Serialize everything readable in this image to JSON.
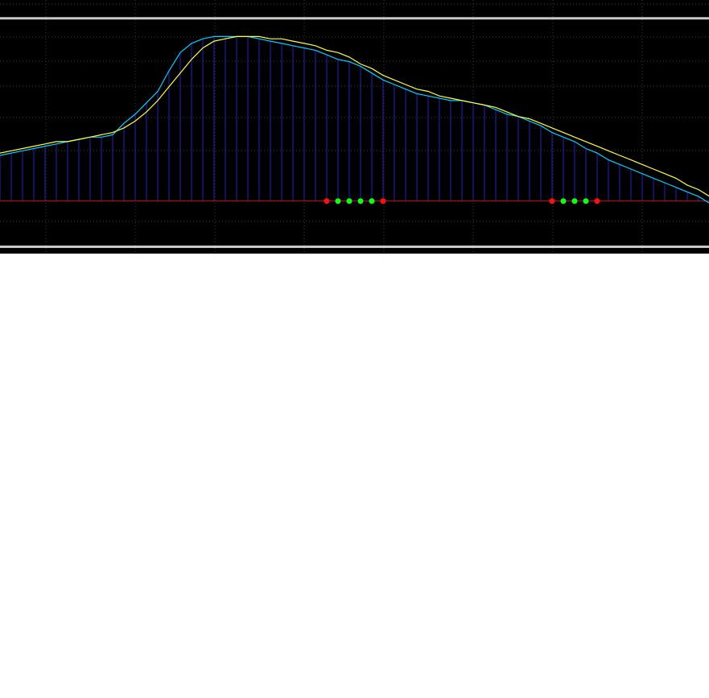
{
  "colors": {
    "background": "#000000",
    "grid": "#3a3a3a",
    "level_lines": "#c8c8c8",
    "positive_histogram": "#1a1aa8",
    "negative_histogram": "#d01010",
    "zero_line": "#d01010",
    "fast_line": "#00cfff",
    "signal_line": "#ffff40",
    "dot_red": "#ff1010",
    "dot_green": "#10ff10"
  },
  "chart_data": {
    "type": "line",
    "title": "",
    "xlabel": "",
    "ylabel": "",
    "grid": true,
    "ylim": [
      -0.23,
      0.88
    ],
    "levels": [
      0.8,
      -0.2
    ],
    "zero_level": 0,
    "histogram": [
      0.2,
      0.21,
      0.22,
      0.23,
      0.24,
      0.25,
      0.26,
      0.27,
      0.28,
      0.28,
      0.29,
      0.34,
      0.38,
      0.43,
      0.48,
      0.57,
      0.65,
      0.69,
      0.71,
      0.72,
      0.72,
      0.72,
      0.72,
      0.71,
      0.7,
      0.69,
      0.68,
      0.67,
      0.66,
      0.64,
      0.62,
      0.61,
      0.59,
      0.56,
      0.53,
      0.51,
      0.49,
      0.47,
      0.46,
      0.45,
      0.44,
      0.44,
      0.43,
      0.42,
      0.4,
      0.38,
      0.37,
      0.35,
      0.33,
      0.3,
      0.28,
      0.26,
      0.23,
      0.21,
      0.18,
      0.16,
      0.14,
      0.12,
      0.1,
      0.08,
      0.06,
      0.04,
      0.02,
      -0.01,
      -0.03,
      -0.05,
      -0.08,
      -0.1,
      -0.12,
      -0.14,
      -0.15
    ],
    "series": [
      {
        "values": [
          0.2,
          0.21,
          0.22,
          0.23,
          0.24,
          0.25,
          0.26,
          0.27,
          0.28,
          0.28,
          0.29,
          0.34,
          0.38,
          0.43,
          0.48,
          0.57,
          0.65,
          0.69,
          0.71,
          0.72,
          0.72,
          0.72,
          0.72,
          0.71,
          0.7,
          0.69,
          0.68,
          0.67,
          0.66,
          0.64,
          0.62,
          0.61,
          0.59,
          0.56,
          0.53,
          0.51,
          0.49,
          0.47,
          0.46,
          0.45,
          0.44,
          0.44,
          0.43,
          0.42,
          0.4,
          0.38,
          0.37,
          0.35,
          0.33,
          0.3,
          0.28,
          0.26,
          0.23,
          0.21,
          0.18,
          0.16,
          0.14,
          0.12,
          0.1,
          0.08,
          0.06,
          0.04,
          0.02,
          -0.01,
          -0.03,
          -0.05,
          -0.08,
          -0.1,
          -0.12,
          -0.14,
          -0.15
        ],
        "color": "#00cfff"
      },
      {
        "values": [
          0.21,
          0.22,
          0.23,
          0.24,
          0.25,
          0.26,
          0.26,
          0.27,
          0.28,
          0.29,
          0.3,
          0.32,
          0.35,
          0.39,
          0.44,
          0.5,
          0.56,
          0.62,
          0.67,
          0.7,
          0.71,
          0.72,
          0.72,
          0.72,
          0.71,
          0.71,
          0.7,
          0.69,
          0.68,
          0.66,
          0.65,
          0.63,
          0.6,
          0.58,
          0.55,
          0.53,
          0.51,
          0.49,
          0.48,
          0.46,
          0.45,
          0.44,
          0.43,
          0.42,
          0.41,
          0.39,
          0.37,
          0.36,
          0.34,
          0.32,
          0.3,
          0.28,
          0.26,
          0.24,
          0.22,
          0.2,
          0.18,
          0.16,
          0.14,
          0.12,
          0.1,
          0.07,
          0.05,
          0.02,
          0.0,
          -0.02,
          -0.05,
          -0.07,
          -0.1,
          -0.12,
          -0.13
        ],
        "color": "#ffff40"
      }
    ],
    "signal_dots": [
      {
        "index": 29,
        "color": "red"
      },
      {
        "index": 30,
        "color": "green"
      },
      {
        "index": 31,
        "color": "green"
      },
      {
        "index": 32,
        "color": "green"
      },
      {
        "index": 33,
        "color": "green"
      },
      {
        "index": 34,
        "color": "red"
      },
      {
        "index": 49,
        "color": "red"
      },
      {
        "index": 50,
        "color": "green"
      },
      {
        "index": 51,
        "color": "green"
      },
      {
        "index": 52,
        "color": "green"
      },
      {
        "index": 53,
        "color": "red"
      }
    ]
  }
}
